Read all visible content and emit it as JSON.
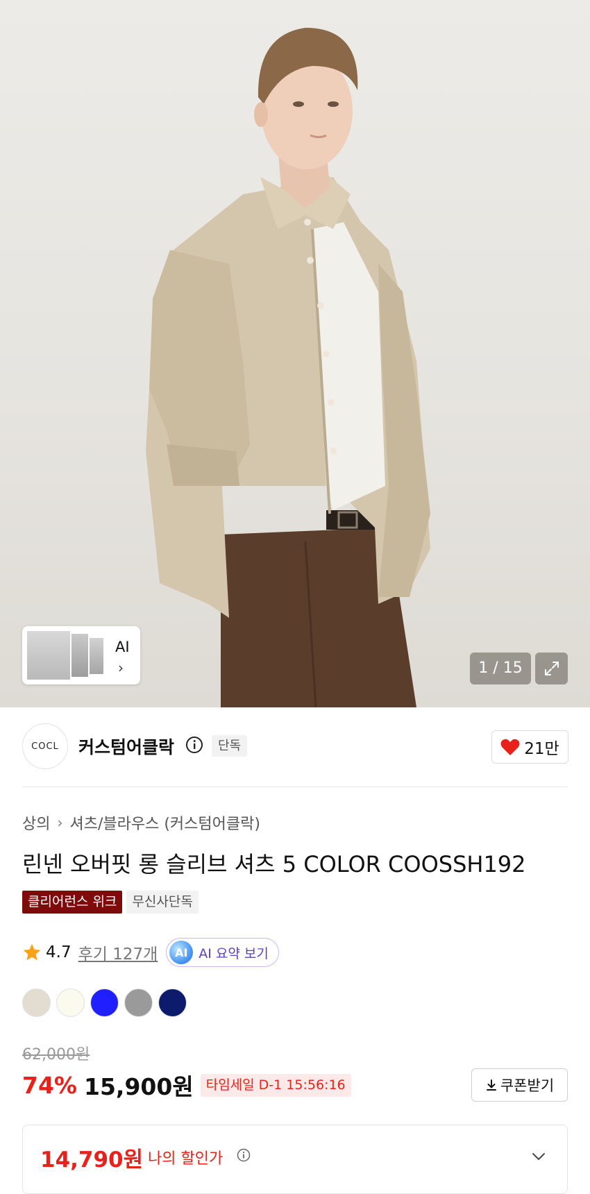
{
  "gallery": {
    "ai_thumb_label": "AI",
    "counter": "1 / 15"
  },
  "brand": {
    "logo_text": "COCL",
    "name": "커스텀어클락",
    "badge": "단독",
    "likes": "21만"
  },
  "breadcrumb": [
    "상의",
    "셔츠/블라우스 (커스텀어클락)"
  ],
  "product": {
    "title": "린넨 오버핏 롱 슬리브 셔츠 5 COLOR COOSSH192",
    "tags": [
      "클리어런스 위크",
      "무신사단독"
    ]
  },
  "rating": {
    "score": "4.7",
    "reviews": "후기 127개",
    "ai_summary_icon": "AI",
    "ai_summary_label": "AI 요약 보기"
  },
  "colors": [
    "#e2ddd0",
    "#fbfaee",
    "#1f1fff",
    "#9a9a9a",
    "#0c1b6b"
  ],
  "price": {
    "original": "62,000원",
    "discount": "74%",
    "sale": "15,900원",
    "time_sale": "타임세일 D-1 15:56:16",
    "coupon_label": "쿠폰받기",
    "my_price": "14,790원",
    "my_price_label": "나의 할인가"
  }
}
